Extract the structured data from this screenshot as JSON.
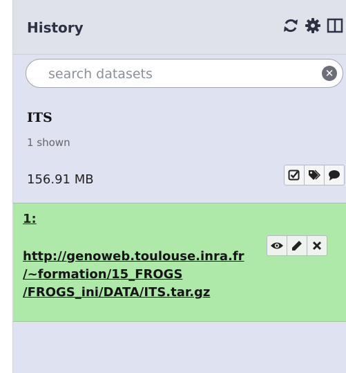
{
  "header": {
    "title": "History",
    "icons": [
      "refresh-icon",
      "gear-icon",
      "columns-icon"
    ]
  },
  "search": {
    "placeholder": "search datasets",
    "value": ""
  },
  "history": {
    "name": "ITS",
    "shown": "1 shown",
    "size": "156.91 MB",
    "actions": [
      "check-square-icon",
      "tags-icon",
      "comment-icon"
    ]
  },
  "dataset": {
    "hid": "1:",
    "title_lines": [
      "http://genoweb.toulouse.inra.fr",
      "/~formation/15_FROGS",
      "/FROGS_ini/DATA/ITS.tar.gz"
    ],
    "actions": [
      "eye-icon",
      "pencil-icon",
      "delete-icon"
    ],
    "state_color": "#aee9aa"
  },
  "colors": {
    "header_bg": "#dfe2e8",
    "body_bg": "#dfe2f0",
    "ok_dataset": "#aee9aa"
  }
}
